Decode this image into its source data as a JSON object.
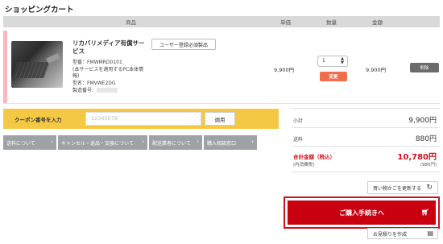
{
  "page": {
    "title": "ショッピングカート"
  },
  "table_header": {
    "product": "商品",
    "unit_price": "単価",
    "quantity": "数量",
    "amount": "金額"
  },
  "item": {
    "name": "リカバリメディア有償サービス",
    "register_button": "ユーザー登録必須製品",
    "model_number": "型番：FMWMRD0101",
    "note": "(本サービスを適用するPC本体情報)",
    "model_name": "型名：FMVWE2DG",
    "serial": "製造番号：",
    "unit_price": "9,900円",
    "quantity_value": "1",
    "change_button": "変更",
    "amount": "9,900円",
    "delete_button": "削除"
  },
  "coupon": {
    "label": "クーポン番号を入力",
    "placeholder": "12345678",
    "apply_button": "適用"
  },
  "info_links": [
    "送料について",
    "キャンセル・返品・交換について",
    "配送業者について",
    "購入相談窓口"
  ],
  "summary": {
    "subtotal_label": "小計",
    "subtotal_value": "9,900円",
    "shipping_label": "送料",
    "shipping_value": "880円",
    "total_label": "合計金額（税込）",
    "total_sub": "(内消費税)",
    "total_value": "10,780円",
    "tax_value": "(980円)"
  },
  "actions": {
    "update_cart": "買い物かごを更新する",
    "checkout": "ご購入手続きへ",
    "quote": "お見積りを作成"
  },
  "colors": {
    "accent_red": "#c8000f",
    "coupon_bg": "#f5c844",
    "change_button": "#f06c4a"
  }
}
